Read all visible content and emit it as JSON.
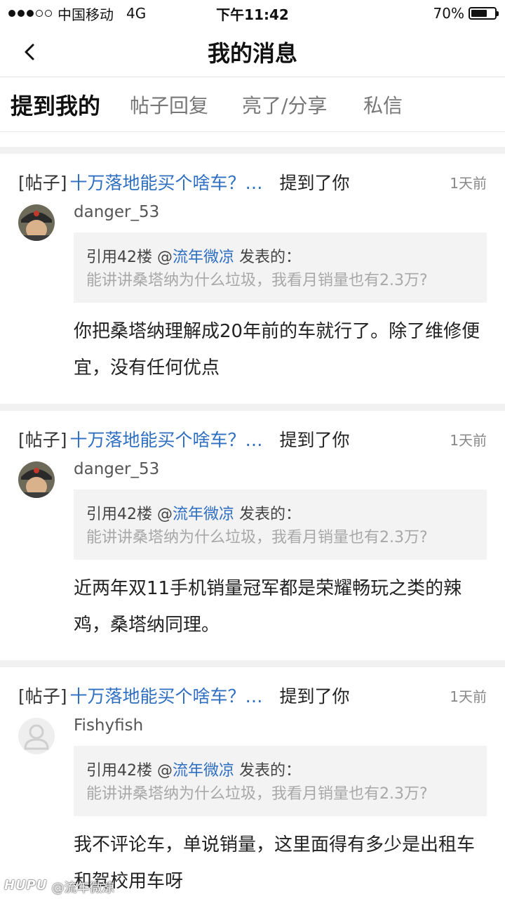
{
  "status_bar": {
    "carrier": "中国移动",
    "network": "4G",
    "time": "下午11:42",
    "battery": "70%",
    "battery_level": 0.7
  },
  "nav": {
    "title": "我的消息",
    "back_icon": "chevron-left-icon"
  },
  "tabs": [
    {
      "label": "提到我的",
      "active": true
    },
    {
      "label": "帖子回复",
      "active": false
    },
    {
      "label": "亮了/分享",
      "active": false
    },
    {
      "label": "私信",
      "active": false
    }
  ],
  "messages": [
    {
      "tag": "[帖子]",
      "post_title": "十万落地能买个啥车？…",
      "mention": "提到了你",
      "time_ago": "1天前",
      "username": "danger_53",
      "avatar": "photo",
      "quote_prefix": "引用42楼 @",
      "quote_user": "流年微凉",
      "quote_suffix": " 发表的：",
      "quote_text": "能讲讲桑塔纳为什么垃圾，我看月销量也有2.3万?",
      "body": "你把桑塔纳理解成20年前的车就行了。除了维修便宜，没有任何优点"
    },
    {
      "tag": "[帖子]",
      "post_title": "十万落地能买个啥车？…",
      "mention": "提到了你",
      "time_ago": "1天前",
      "username": "danger_53",
      "avatar": "photo",
      "quote_prefix": "引用42楼 @",
      "quote_user": "流年微凉",
      "quote_suffix": " 发表的：",
      "quote_text": "能讲讲桑塔纳为什么垃圾，我看月销量也有2.3万?",
      "body": "近两年双11手机销量冠军都是荣耀畅玩之类的辣鸡，桑塔纳同理。"
    },
    {
      "tag": "[帖子]",
      "post_title": "十万落地能买个啥车？…",
      "mention": "提到了你",
      "time_ago": "1天前",
      "username": "Fishyfish",
      "avatar": "default",
      "quote_prefix": "引用42楼 @",
      "quote_user": "流年微凉",
      "quote_suffix": " 发表的：",
      "quote_text": "能讲讲桑塔纳为什么垃圾，我看月销量也有2.3万?",
      "body": "我不评论车，单说销量，这里面得有多少是出租车和驾校用车呀"
    }
  ],
  "watermark": {
    "brand": "HUPU",
    "handle": "@流年微凉"
  }
}
